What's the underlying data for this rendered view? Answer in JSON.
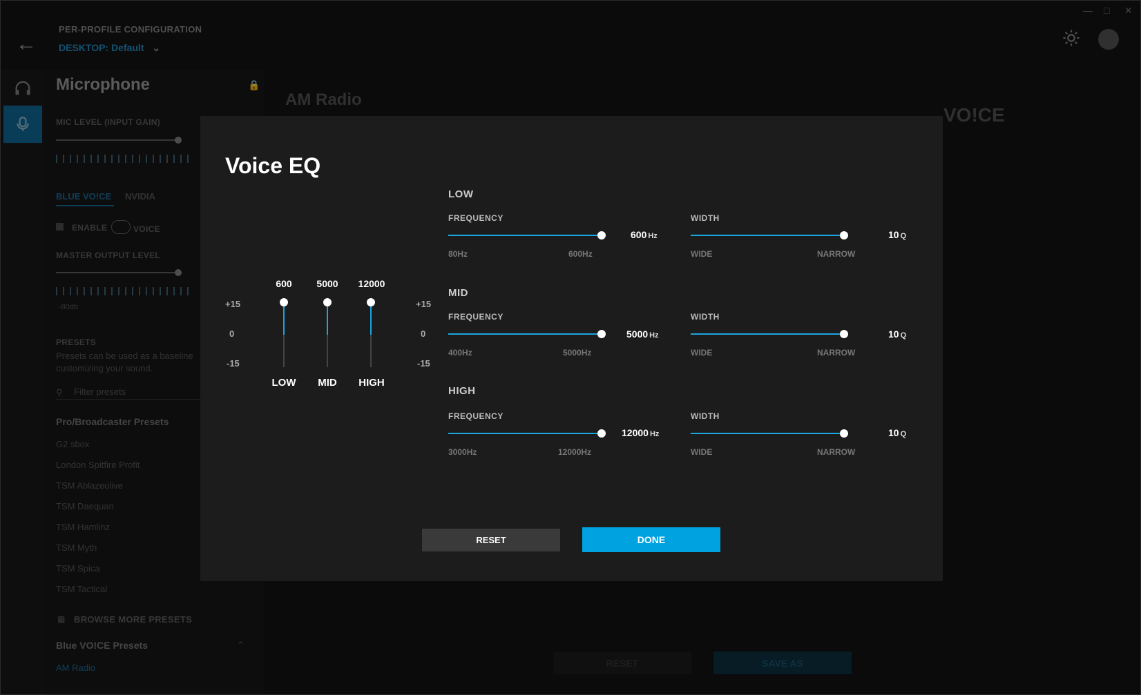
{
  "header": {
    "config_title": "PER-PROFILE CONFIGURATION",
    "profile_label": "DESKTOP: Default"
  },
  "sidebar": {
    "title": "Microphone",
    "mic_level_label": "MIC LEVEL (INPUT GAIN)",
    "tabs": [
      "BLUE VO!CE",
      "NVIDIA"
    ],
    "enable_label": "ENABLE",
    "enable_voice_label": "VOICE",
    "master_output_label": "MASTER OUTPUT LEVEL",
    "db_label": "-80db",
    "presets_title": "PRESETS",
    "presets_desc_1": "Presets can be used as a baseline",
    "presets_desc_2": "customizing your sound.",
    "filter_placeholder": "Filter presets",
    "pro_presets_title": "Pro/Broadcaster Presets",
    "pro_presets": [
      "G2 sbox",
      "London Spitfire Profit",
      "TSM Ablazeolive",
      "TSM Daequan",
      "TSM Hamlinz",
      "TSM Myth",
      "TSM Spica",
      "TSM Tactical"
    ],
    "browse_more": "BROWSE MORE PRESETS",
    "blue_presets_title": "Blue VO!CE Presets",
    "blue_presets": [
      "AM Radio"
    ]
  },
  "main": {
    "preset_title": "AM Radio",
    "voice_logo": "VO!CE",
    "reset_label": "RESET",
    "save_as_label": "SAVE AS"
  },
  "modal": {
    "title": "Voice EQ",
    "scale": {
      "top": "+15",
      "mid": "0",
      "bottom": "-15"
    },
    "bands": [
      {
        "name": "LOW",
        "label": "LOW",
        "value_top": "600",
        "gain": 15,
        "frequency_label": "FREQUENCY",
        "freq_value": "600",
        "freq_unit": "Hz",
        "freq_min": "80Hz",
        "freq_max": "600Hz",
        "freq_fraction": 1.0,
        "width_label": "WIDTH",
        "width_value": "10",
        "width_unit": "Q",
        "width_min": "WIDE",
        "width_max": "NARROW",
        "width_fraction": 1.0
      },
      {
        "name": "MID",
        "label": "MID",
        "value_top": "5000",
        "gain": 15,
        "frequency_label": "FREQUENCY",
        "freq_value": "5000",
        "freq_unit": "Hz",
        "freq_min": "400Hz",
        "freq_max": "5000Hz",
        "freq_fraction": 1.0,
        "width_label": "WIDTH",
        "width_value": "10",
        "width_unit": "Q",
        "width_min": "WIDE",
        "width_max": "NARROW",
        "width_fraction": 1.0
      },
      {
        "name": "HIGH",
        "label": "HIGH",
        "value_top": "12000",
        "gain": 15,
        "frequency_label": "FREQUENCY",
        "freq_value": "12000",
        "freq_unit": "Hz",
        "freq_min": "3000Hz",
        "freq_max": "12000Hz",
        "freq_fraction": 1.0,
        "width_label": "WIDTH",
        "width_value": "10",
        "width_unit": "Q",
        "width_min": "WIDE",
        "width_max": "NARROW",
        "width_fraction": 1.0
      }
    ],
    "reset_label": "RESET",
    "done_label": "DONE"
  },
  "colors": {
    "accent": "#1aa6e0",
    "done_button": "#00a3e0",
    "modal_bg": "#1c1c1c"
  },
  "icons": [
    "back-arrow-icon",
    "gear-icon",
    "headset-icon",
    "microphone-icon",
    "lock-icon",
    "search-icon",
    "grid-icon",
    "chevron-up-icon",
    "chevron-down-icon"
  ]
}
